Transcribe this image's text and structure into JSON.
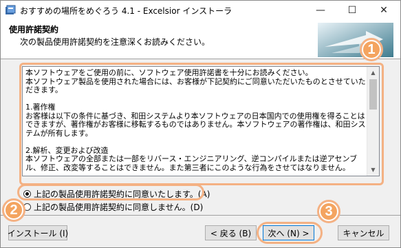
{
  "window": {
    "title": "おすすめの場所をめぐろう 4.1 - Excelsior インストーラ",
    "minimize_glyph": "—",
    "maximize_glyph": "☐",
    "close_glyph": "✕"
  },
  "header": {
    "title": "使用許諾契約",
    "subtitle": "次の製品使用許諾契約を注意深くお読みください。"
  },
  "license": {
    "text": "本ソフトウェアをご使用の前に、ソフトウェア使用許諾書を十分にお読みください。\n本ソフトウェア製品を使用された場合には、お客様が下記契約にご同意いただいたものとさせていただきます。\n\n1.著作権\nお客様は以下の条件に基づき、和田システムより本ソフトウェアの日本国内での使用権を得ることはできますが、著作権がお客様に移転するものではありません。本ソフトウェアの著作権は、和田システムが所有します。\n\n2.解析、変更および改造\n本ソフトウェアの全部または一部をリバース・エンジニアリング、逆コンパイルまたは逆アセンブル、修正、改変等することはできません。また第三者にこのような行為をさせてはなりません。"
  },
  "radios": [
    {
      "label": "上記の製品使用許諾契約に同意いたします。(A)",
      "selected": true
    },
    {
      "label": "上記の製品使用許諾契約に同意しません。(D)",
      "selected": false
    }
  ],
  "buttons": {
    "install": "インストール (I)",
    "back": "< 戻る (B)",
    "next": "次へ (N) >",
    "cancel": "キャンセル"
  },
  "annotations": [
    "1",
    "2",
    "3"
  ],
  "colors": {
    "annotation": "#f4b183",
    "default_button_border": "#0078d7"
  }
}
